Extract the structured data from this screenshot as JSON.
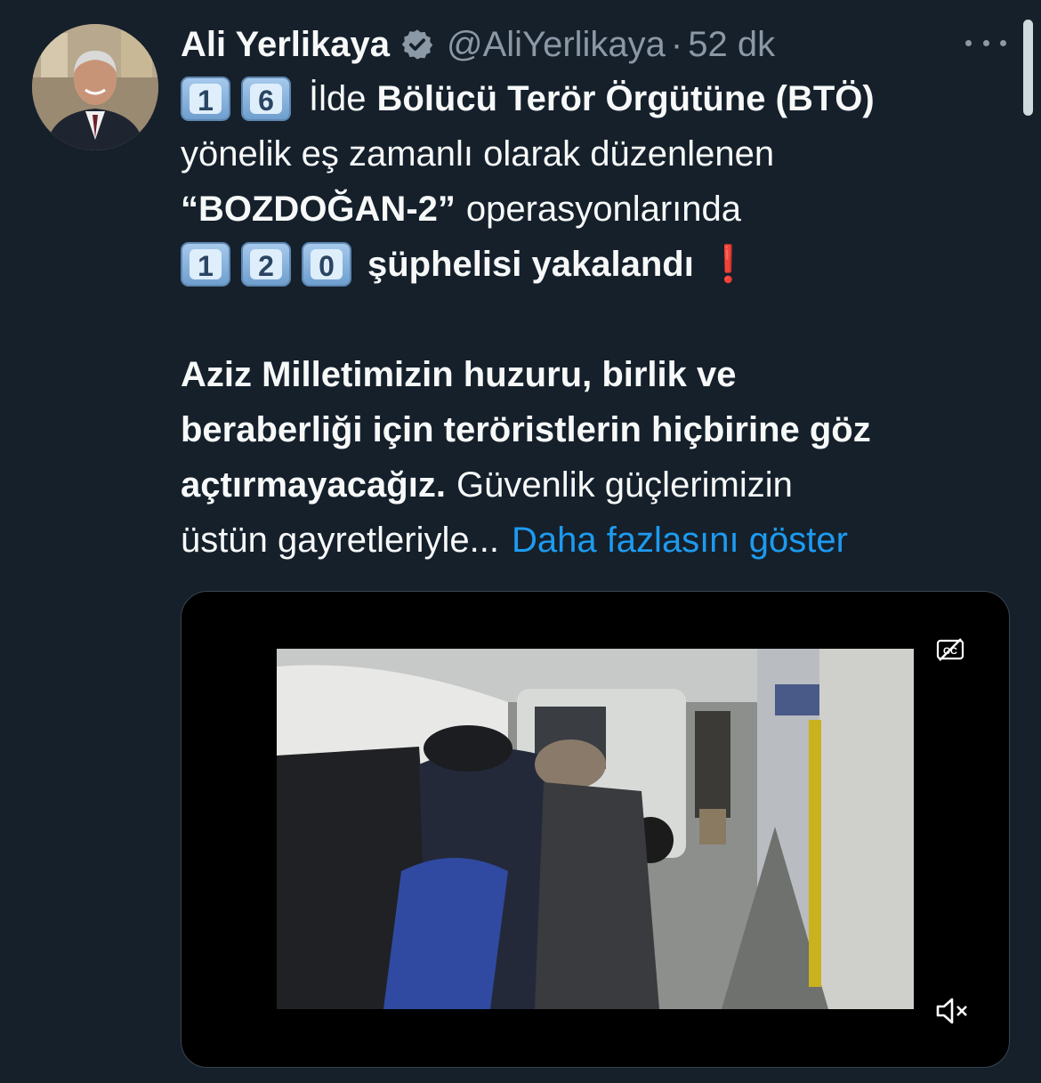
{
  "author": {
    "name": "Ali Yerlikaya",
    "handle": "@AliYerlikaya",
    "separator": "·",
    "time": "52 dk",
    "verified_icon": "verified-badge-icon",
    "verified_color": "#8b98a5"
  },
  "tweet": {
    "line1_keys": [
      "1",
      "6"
    ],
    "line1_plain": "İlde",
    "line1_bold": "Bölücü Terör Örgütüne (BTÖ)",
    "line2": "yönelik eş zamanlı olarak düzenlenen",
    "line3_bold": "“BOZDOĞAN-2”",
    "line3_plain": "operasyonlarında",
    "line4_keys": [
      "1",
      "2",
      "0"
    ],
    "line4_bold": "şüphelisi yakalandı",
    "line4_emoji": "❗",
    "para2_line1": "Aziz Milletimizin huzuru, birlik ve",
    "para2_line2": "beraberliği için teröristlerin hiçbirine göz",
    "para2_line3_bold": "açtırmayacağız.",
    "para2_line3_plain": "Güvenlik güçlerimizin",
    "para2_line4_plain": "üstün gayretleriyle...",
    "show_more": "Daha fazlasını göster"
  },
  "media": {
    "type": "video",
    "captions_icon": "closed-captions-off-icon",
    "mute_icon": "volume-muted-icon"
  },
  "colors": {
    "background": "#15202b",
    "text": "#f7f9f9",
    "secondary": "#8b98a5",
    "link": "#1d9bf0",
    "accent_red": "#dd2e44"
  }
}
